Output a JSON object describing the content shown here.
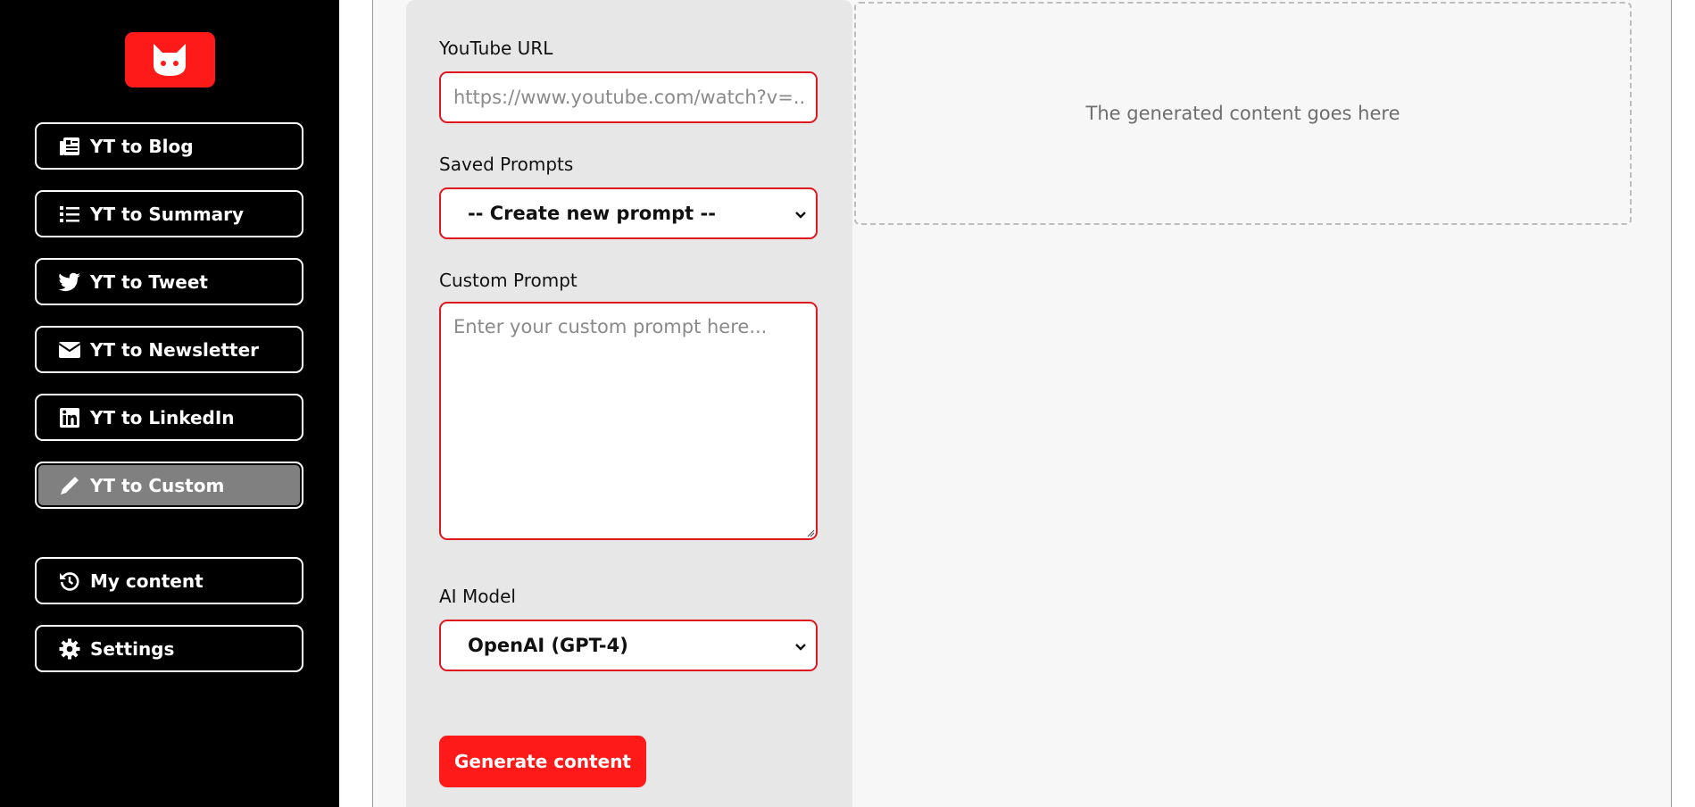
{
  "sidebar": {
    "logo_icon": "cat-face-icon",
    "nav_items": [
      {
        "label": "YT to Blog",
        "icon": "newspaper-icon"
      },
      {
        "label": "YT to Summary",
        "icon": "list-icon"
      },
      {
        "label": "YT to Tweet",
        "icon": "twitter-bird-icon"
      },
      {
        "label": "YT to Newsletter",
        "icon": "envelope-icon"
      },
      {
        "label": "YT to LinkedIn",
        "icon": "linkedin-icon"
      },
      {
        "label": "YT to Custom",
        "icon": "pencil-icon",
        "active": true
      }
    ],
    "secondary_items": [
      {
        "label": "My content",
        "icon": "history-icon"
      },
      {
        "label": "Settings",
        "icon": "gear-icon"
      }
    ]
  },
  "form": {
    "youtube_url": {
      "label": "YouTube URL",
      "value": "",
      "placeholder": "https://www.youtube.com/watch?v=..."
    },
    "saved_prompts": {
      "label": "Saved Prompts",
      "selected": "-- Create new prompt --"
    },
    "custom_prompt": {
      "label": "Custom Prompt",
      "value": "",
      "placeholder": "Enter your custom prompt here..."
    },
    "ai_model": {
      "label": "AI Model",
      "selected": "OpenAI (GPT-4)"
    },
    "generate_label": "Generate content"
  },
  "output": {
    "placeholder_text": "The generated content goes here"
  },
  "colors": {
    "accent": "#ff1a1a",
    "sidebar_bg": "#000000",
    "active_nav": "#808080",
    "panel_bg": "#e7e7e7"
  }
}
